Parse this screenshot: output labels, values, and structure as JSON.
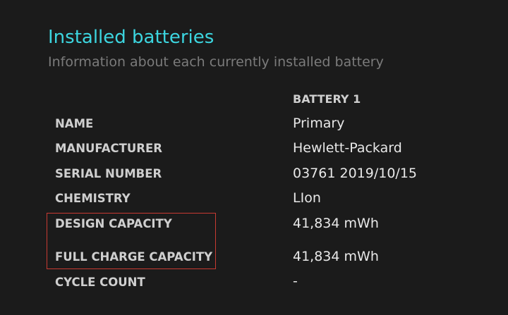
{
  "report": {
    "title": "Installed batteries",
    "subtitle": "Information about each currently installed battery",
    "column_header": "BATTERY 1",
    "rows": [
      {
        "label": "NAME",
        "value": "Primary"
      },
      {
        "label": "MANUFACTURER",
        "value": "Hewlett-Packard"
      },
      {
        "label": "SERIAL NUMBER",
        "value": "03761 2019/10/15"
      },
      {
        "label": "CHEMISTRY",
        "value": "LIon"
      },
      {
        "label": "DESIGN CAPACITY",
        "value": "41,834 mWh"
      },
      {
        "label": "FULL CHARGE CAPACITY",
        "value": "41,834 mWh"
      },
      {
        "label": "CYCLE COUNT",
        "value": "-"
      }
    ]
  },
  "colors": {
    "background": "#1b1b1b",
    "title": "#3cd5df",
    "subtitle": "#7b7b7b",
    "highlight_border": "#c83a32"
  }
}
